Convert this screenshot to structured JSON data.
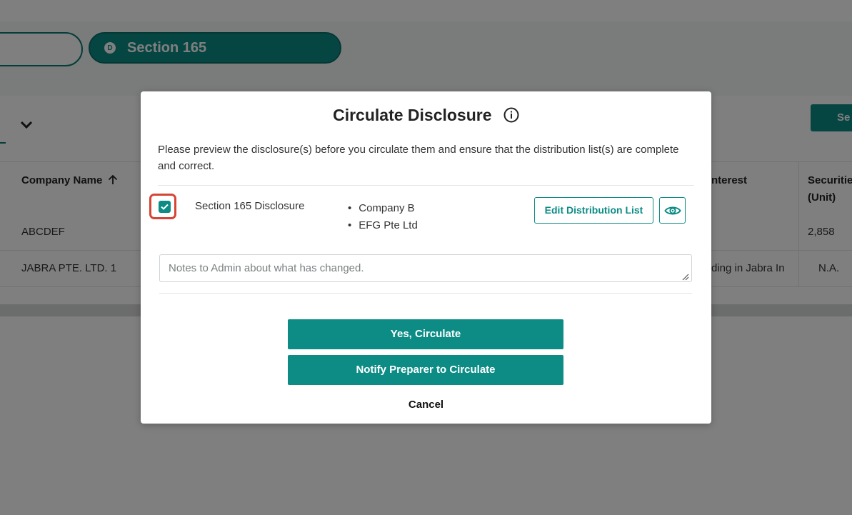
{
  "background": {
    "section_pill": {
      "badge": "D",
      "label": "Section 165"
    },
    "search_button_label": "Se",
    "table": {
      "headers": {
        "company_name": "Company Name",
        "interest": "nterest",
        "securities_line1": "Securitie",
        "securities_line2": "(Unit)"
      },
      "rows": [
        {
          "company": "ABCDEF",
          "interest": "",
          "securities": "2,858"
        },
        {
          "company": "JABRA PTE. LTD. 1",
          "interest": "ding in Jabra In",
          "securities": "N.A."
        }
      ]
    }
  },
  "modal": {
    "title": "Circulate Disclosure",
    "description": "Please preview the disclosure(s) before you circulate them and ensure that the distribution list(s) are complete and correct.",
    "disclosures": [
      {
        "name": "Section 165 Disclosure",
        "checked": true,
        "distribution": [
          "Company B",
          "EFG Pte Ltd"
        ],
        "edit_label": "Edit Distribution List"
      }
    ],
    "notes_placeholder": "Notes to Admin about what has changed.",
    "primary_label": "Yes, Circulate",
    "notify_label": "Notify Preparer to Circulate",
    "cancel_label": "Cancel"
  },
  "colors": {
    "accent": "#0c8c85",
    "highlight": "#d54535"
  }
}
